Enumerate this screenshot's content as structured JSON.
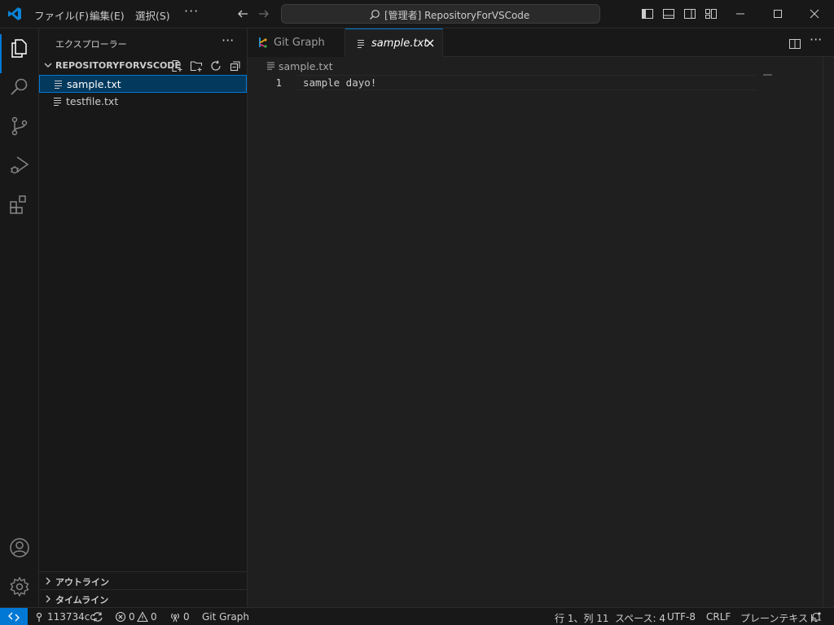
{
  "titlebar": {
    "menus": [
      "ファイル(F)",
      "編集(E)",
      "選択(S)"
    ],
    "more": "···",
    "search_text": "[管理者] RepositoryForVSCode"
  },
  "sidebar": {
    "title": "エクスプローラー",
    "more": "···",
    "folder": "REPOSITORYFORVSCODE",
    "files": [
      {
        "label": "sample.txt",
        "selected": true
      },
      {
        "label": "testfile.txt",
        "selected": false
      }
    ],
    "panels": [
      "アウトライン",
      "タイムライン"
    ]
  },
  "tabs": [
    {
      "label": "Git Graph",
      "active": false
    },
    {
      "label": "sample.txt",
      "active": true
    }
  ],
  "breadcrumb": "sample.txt",
  "editor": {
    "lines": [
      {
        "number": "1",
        "text": "sample dayo!"
      }
    ]
  },
  "statusbar": {
    "branch": "113734cc",
    "errors": "0",
    "warnings": "0",
    "ports": "0",
    "git_graph": "Git Graph",
    "position": "行 1、列 11",
    "spaces": "スペース: 4",
    "encoding": "UTF-8",
    "eol": "CRLF",
    "language": "プレーンテキスト"
  },
  "colors": {
    "accent": "#0078d4",
    "background": "#1f1f1f",
    "chrome": "#181818"
  }
}
